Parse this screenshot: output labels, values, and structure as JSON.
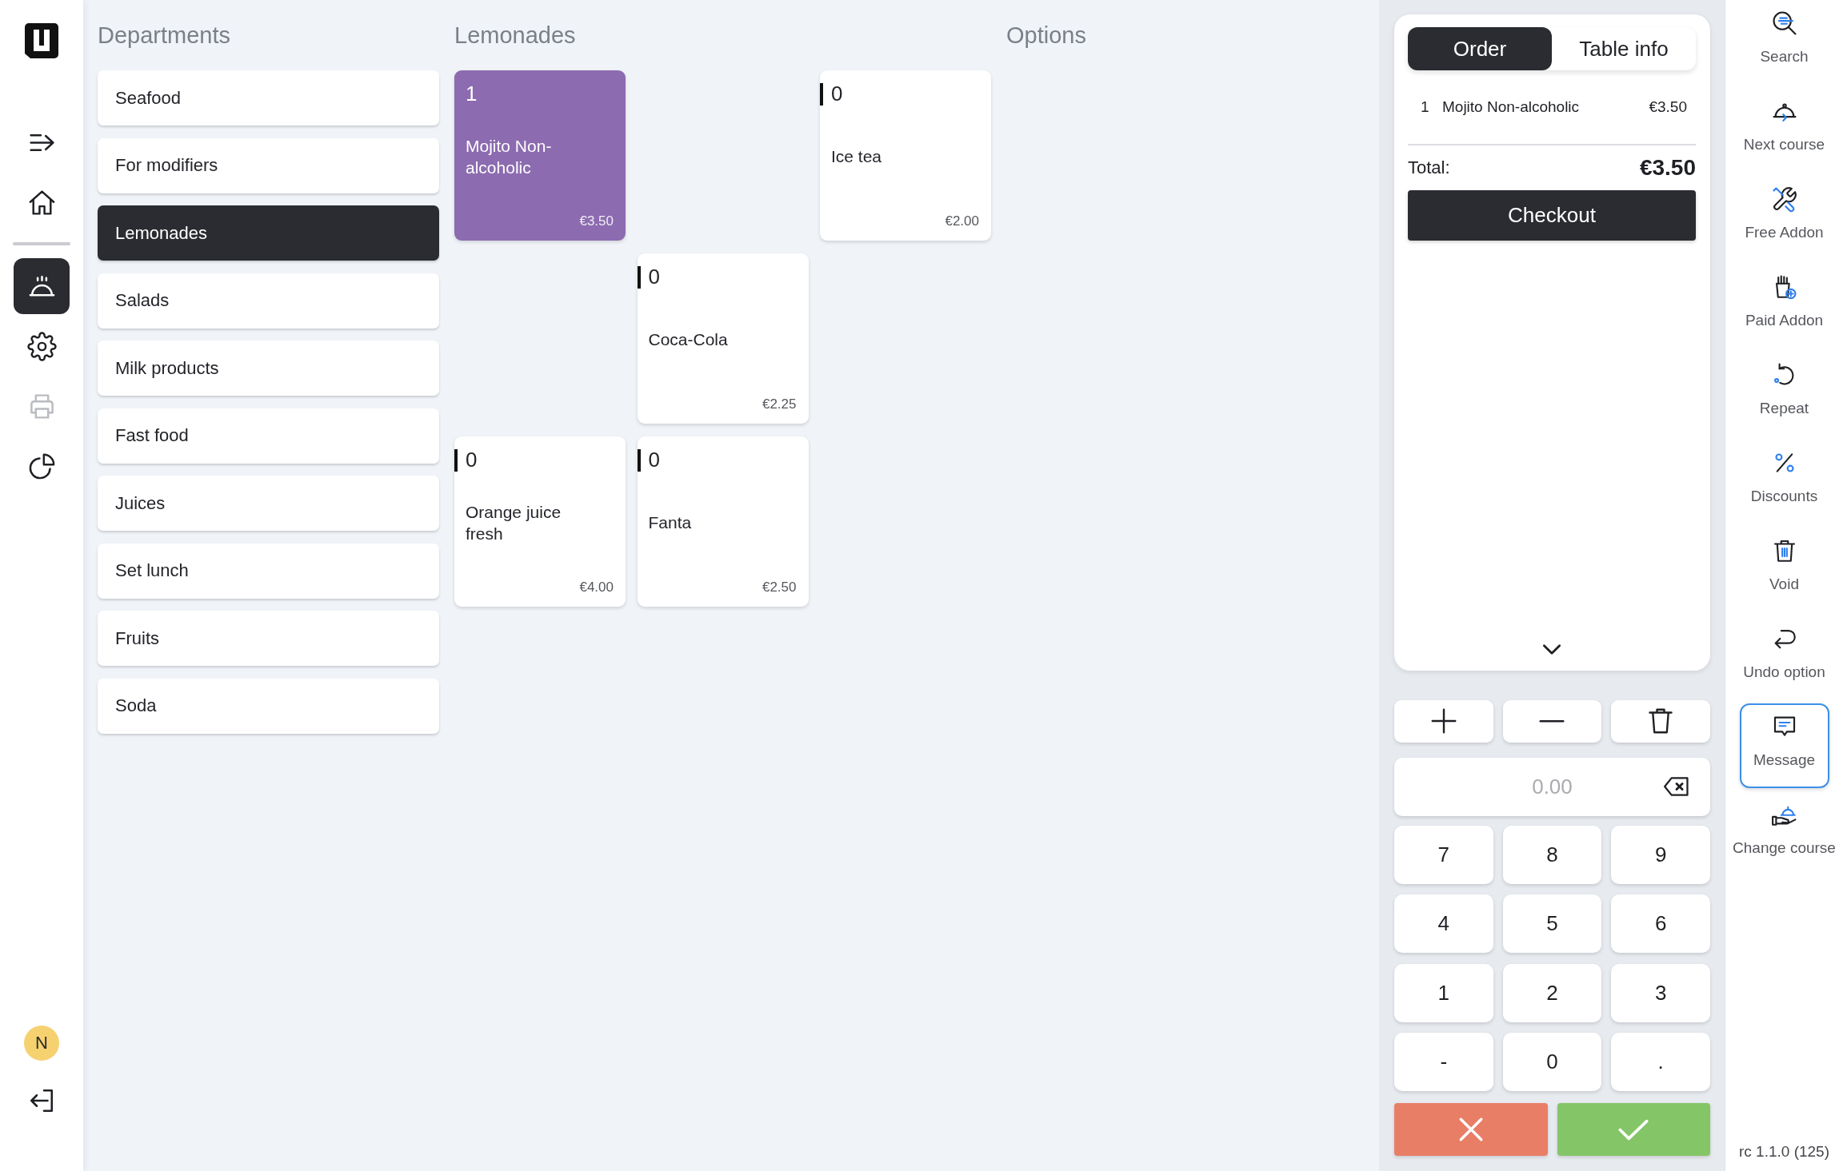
{
  "sidebar": {
    "groups": [
      {
        "items": [
          {
            "selected": false,
            "disabled": false
          },
          {
            "selected": false,
            "disabled": false
          }
        ]
      },
      {
        "items": [
          {
            "selected": true,
            "disabled": false
          },
          {
            "selected": false,
            "disabled": false
          },
          {
            "selected": false,
            "disabled": true
          },
          {
            "selected": false,
            "disabled": false
          }
        ]
      }
    ],
    "user": {
      "initial": "N"
    }
  },
  "departments": {
    "title": "Departments",
    "items": [
      {
        "label": "Seafood",
        "selected": false
      },
      {
        "label": "For modifiers",
        "selected": false
      },
      {
        "label": "Lemonades",
        "selected": true
      },
      {
        "label": "Salads",
        "selected": false
      },
      {
        "label": "Milk products",
        "selected": false
      },
      {
        "label": "Fast food",
        "selected": false
      },
      {
        "label": "Juices",
        "selected": false
      },
      {
        "label": "Set lunch",
        "selected": false
      },
      {
        "label": "Fruits",
        "selected": false
      },
      {
        "label": "Soda",
        "selected": false
      }
    ]
  },
  "products": {
    "title": "Lemonades",
    "rows": [
      {
        "slots": [
          {
            "kind": "product",
            "quantity": "1",
            "name": "Mojito Non-alcoholic",
            "price": "€3.50",
            "selected": true
          },
          {
            "kind": "empty"
          },
          {
            "kind": "product",
            "quantity": "0",
            "name": "Ice tea",
            "price": "€2.00",
            "selected": false
          }
        ]
      },
      {
        "slots": [
          {
            "kind": "empty"
          },
          {
            "kind": "product",
            "quantity": "0",
            "name": "Coca-Cola",
            "price": "€2.25",
            "selected": false
          }
        ]
      },
      {
        "slots": [
          {
            "kind": "product",
            "quantity": "0",
            "name": "Orange juice fresh",
            "price": "€4.00",
            "selected": false
          },
          {
            "kind": "product",
            "quantity": "0",
            "name": "Fanta",
            "price": "€2.50",
            "selected": false
          }
        ]
      }
    ]
  },
  "options": {
    "title": "Options"
  },
  "order_panel": {
    "tabs": [
      {
        "label": "Order",
        "selected": true
      },
      {
        "label": "Table info",
        "selected": false
      }
    ],
    "lines": [
      {
        "quantity": "1",
        "name": "Mojito Non-alcoholic",
        "price": "€3.50"
      }
    ],
    "total": {
      "label": "Total:",
      "value": "€3.50"
    },
    "checkout": "Checkout"
  },
  "keypad": {
    "amount_field": {
      "placeholder": "0.00"
    },
    "keys": [
      "7",
      "8",
      "9",
      "4",
      "5",
      "6",
      "1",
      "2",
      "3",
      "-",
      "0",
      "."
    ]
  },
  "actions": [
    {
      "label": "Search",
      "selected": false
    },
    {
      "label": "Next course",
      "selected": false
    },
    {
      "label": "Free Addon",
      "selected": false
    },
    {
      "label": "Paid Addon",
      "selected": false
    },
    {
      "label": "Repeat",
      "selected": false
    },
    {
      "label": "Discounts",
      "selected": false
    },
    {
      "label": "Void",
      "selected": false
    },
    {
      "label": "Undo option",
      "selected": false
    },
    {
      "label": "Message",
      "selected": true
    },
    {
      "label": "Change course",
      "selected": false
    }
  ],
  "version": "rc 1.1.0 (125)"
}
